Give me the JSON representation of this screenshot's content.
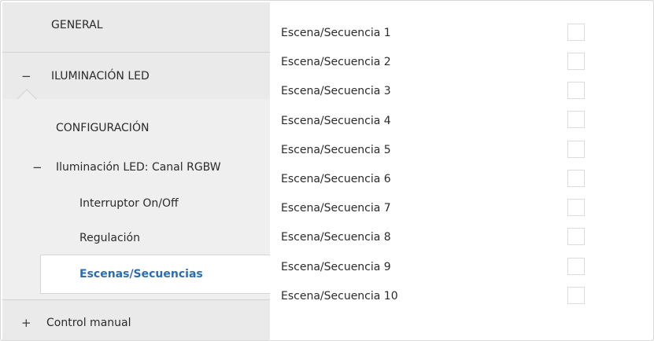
{
  "sidebar": {
    "general": "GENERAL",
    "iluminacion_toggle": "−",
    "iluminacion": "ILUMINACIÓN LED",
    "configuracion": "CONFIGURACIÓN",
    "canal_toggle": "−",
    "canal": "Iluminación LED: Canal RGBW",
    "interruptor": "Interruptor On/Off",
    "regulacion": "Regulación",
    "escenas": "Escenas/Secuencias",
    "control_toggle": "+",
    "control_manual": "Control manual"
  },
  "main": {
    "rows": [
      {
        "label": "Escena/Secuencia 1",
        "checked": false
      },
      {
        "label": "Escena/Secuencia 2",
        "checked": false
      },
      {
        "label": "Escena/Secuencia 3",
        "checked": false
      },
      {
        "label": "Escena/Secuencia 4",
        "checked": false
      },
      {
        "label": "Escena/Secuencia 5",
        "checked": false
      },
      {
        "label": "Escena/Secuencia 6",
        "checked": false
      },
      {
        "label": "Escena/Secuencia 7",
        "checked": false
      },
      {
        "label": "Escena/Secuencia 8",
        "checked": false
      },
      {
        "label": "Escena/Secuencia 9",
        "checked": false
      },
      {
        "label": "Escena/Secuencia 10",
        "checked": false
      }
    ]
  },
  "colors": {
    "selected_text": "#2a6db0",
    "sidebar_bg": "#eaeaea"
  }
}
